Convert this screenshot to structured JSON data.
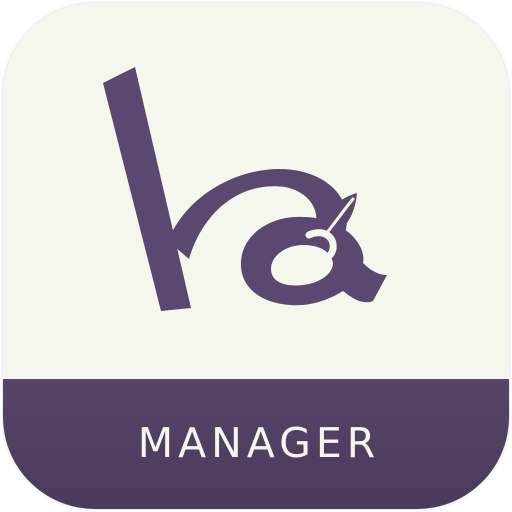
{
  "app_icon": {
    "logo": {
      "monogram_icon": "ka-leaf-monogram-icon",
      "color": "#5a4870"
    },
    "banner": {
      "label": "MANAGER",
      "background_color": "#4f3e62",
      "text_color": "#f6f7ec"
    },
    "background_color": "#f6f7ec"
  }
}
